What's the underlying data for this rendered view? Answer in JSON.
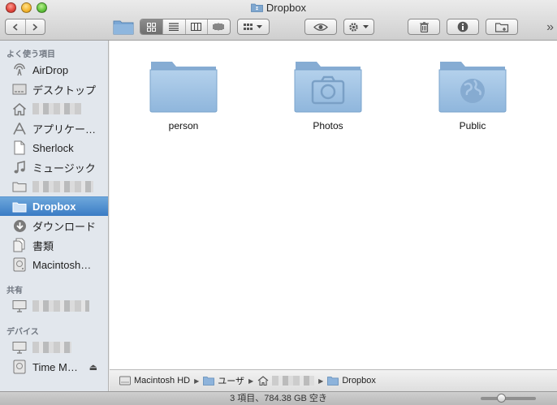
{
  "window": {
    "title": "Dropbox"
  },
  "toolbar": {
    "view_modes": [
      "icon-view",
      "list-view",
      "column-view",
      "coverflow-view"
    ],
    "active_view": "icon-view"
  },
  "sidebar": {
    "sections": [
      {
        "header": "よく使う項目",
        "items": [
          {
            "label": "AirDrop",
            "icon": "airdrop-icon"
          },
          {
            "label": "デスクトップ",
            "icon": "desktop-icon"
          },
          {
            "label": "",
            "icon": "home-icon"
          },
          {
            "label": "アプリケー…",
            "icon": "applications-icon"
          },
          {
            "label": "Sherlock",
            "icon": "document-icon"
          },
          {
            "label": "ミュージック",
            "icon": "music-icon"
          },
          {
            "label": "",
            "icon": "folder-icon"
          },
          {
            "label": "Dropbox",
            "icon": "dropbox-folder-icon",
            "selected": true
          },
          {
            "label": "ダウンロード",
            "icon": "downloads-icon"
          },
          {
            "label": "書類",
            "icon": "documents-icon"
          },
          {
            "label": "Macintosh…",
            "icon": "hard-drive-icon"
          }
        ]
      },
      {
        "header": "共有",
        "items": [
          {
            "label": "",
            "icon": "computer-icon"
          }
        ]
      },
      {
        "header": "デバイス",
        "items": [
          {
            "label": "",
            "icon": "computer-icon"
          },
          {
            "label": "Time M…",
            "icon": "time-machine-icon",
            "ejectable": true
          }
        ]
      }
    ]
  },
  "content": {
    "folders": [
      {
        "label": "person",
        "icon": "folder-icon"
      },
      {
        "label": "Photos",
        "icon": "photos-folder-icon"
      },
      {
        "label": "Public",
        "icon": "public-folder-icon"
      }
    ]
  },
  "pathbar": {
    "items": [
      {
        "label": "Macintosh HD",
        "icon": "hard-drive-icon"
      },
      {
        "label": "ユーザ",
        "icon": "folder-icon"
      },
      {
        "label": "",
        "icon": "home-icon"
      },
      {
        "label": "Dropbox",
        "icon": "dropbox-folder-icon"
      }
    ]
  },
  "statusbar": {
    "text": "3 項目、784.38 GB 空き",
    "icon_size_level": 0.35
  }
}
